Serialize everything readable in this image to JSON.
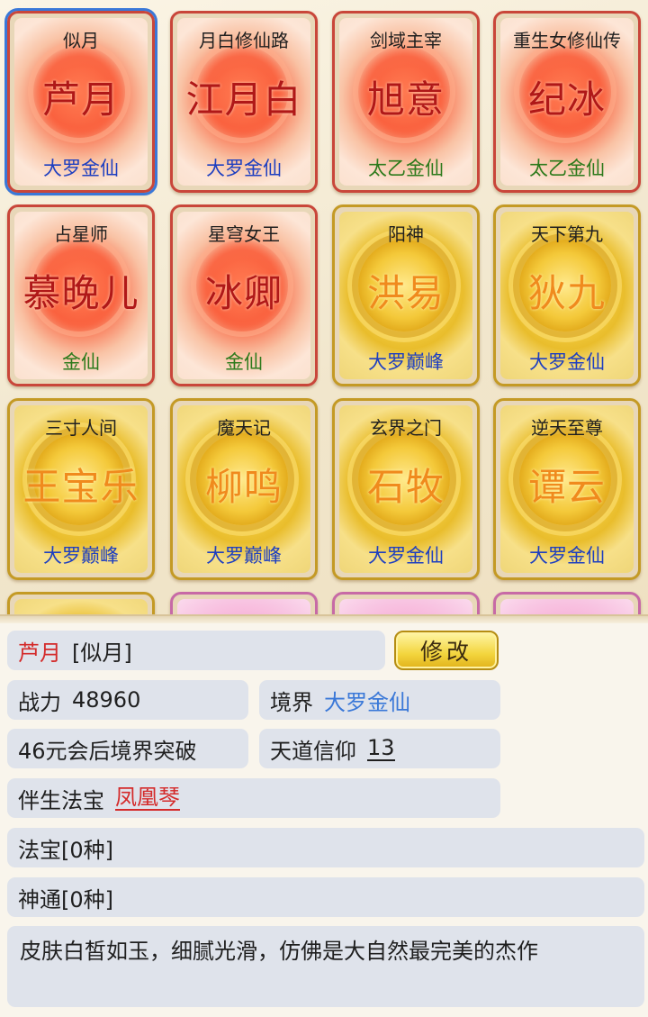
{
  "cards": [
    {
      "title": "似月",
      "name": "芦月",
      "realm": "大罗金仙",
      "style": "red",
      "realm_color": "blue",
      "selected": true
    },
    {
      "title": "月白修仙路",
      "name": "江月白",
      "realm": "大罗金仙",
      "style": "red",
      "realm_color": "blue"
    },
    {
      "title": "剑域主宰",
      "name": "旭意",
      "realm": "太乙金仙",
      "style": "red",
      "realm_color": "green"
    },
    {
      "title": "重生女修仙传",
      "name": "纪冰",
      "realm": "太乙金仙",
      "style": "red",
      "realm_color": "green"
    },
    {
      "title": "占星师",
      "name": "慕晚儿",
      "realm": "金仙",
      "style": "red",
      "realm_color": "green"
    },
    {
      "title": "星穹女王",
      "name": "冰卿",
      "realm": "金仙",
      "style": "red",
      "realm_color": "green"
    },
    {
      "title": "阳神",
      "name": "洪易",
      "realm": "大罗巅峰",
      "style": "gold",
      "realm_color": "blue"
    },
    {
      "title": "天下第九",
      "name": "狄九",
      "realm": "大罗金仙",
      "style": "gold",
      "realm_color": "blue"
    },
    {
      "title": "三寸人间",
      "name": "王宝乐",
      "realm": "大罗巅峰",
      "style": "gold",
      "realm_color": "blue"
    },
    {
      "title": "魔天记",
      "name": "柳鸣",
      "realm": "大罗巅峰",
      "style": "gold",
      "realm_color": "blue"
    },
    {
      "title": "玄界之门",
      "name": "石牧",
      "realm": "大罗金仙",
      "style": "gold",
      "realm_color": "blue"
    },
    {
      "title": "逆天至尊",
      "name": "谭云",
      "realm": "大罗金仙",
      "style": "gold",
      "realm_color": "blue"
    }
  ],
  "detail": {
    "name": "芦月",
    "title": "[似月]",
    "edit_label": "修改",
    "power_label": "战力",
    "power_value": "48960",
    "realm_label": "境界",
    "realm_value": "大罗金仙",
    "breakthrough": "46元会后境界突破",
    "faith_label": "天道信仰",
    "faith_value": "13",
    "treasure_label": "伴生法宝",
    "treasure_value": "凤凰琴",
    "artifacts": "法宝[0种]",
    "powers": "神通[0种]",
    "description": "皮肤白皙如玉，细腻光滑，仿佛是大自然最完美的杰作"
  },
  "colors": {
    "red_border": "#c9463a",
    "gold_border": "#c49a25",
    "selected_outline": "#3a78d8",
    "realm_blue": "#1e3fc0",
    "realm_green": "#2d7a1c",
    "accent_red": "#d42a2a"
  }
}
